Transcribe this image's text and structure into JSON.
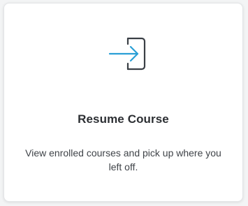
{
  "card": {
    "title": "Resume Course",
    "description": "View enrolled courses and pick up where you left off.",
    "icon": "sign-in-arrow-icon",
    "colors": {
      "accent": "#2a9fd6",
      "icon_outline": "#3a3f45",
      "title": "#2c2f33",
      "text": "#3f4348"
    }
  }
}
